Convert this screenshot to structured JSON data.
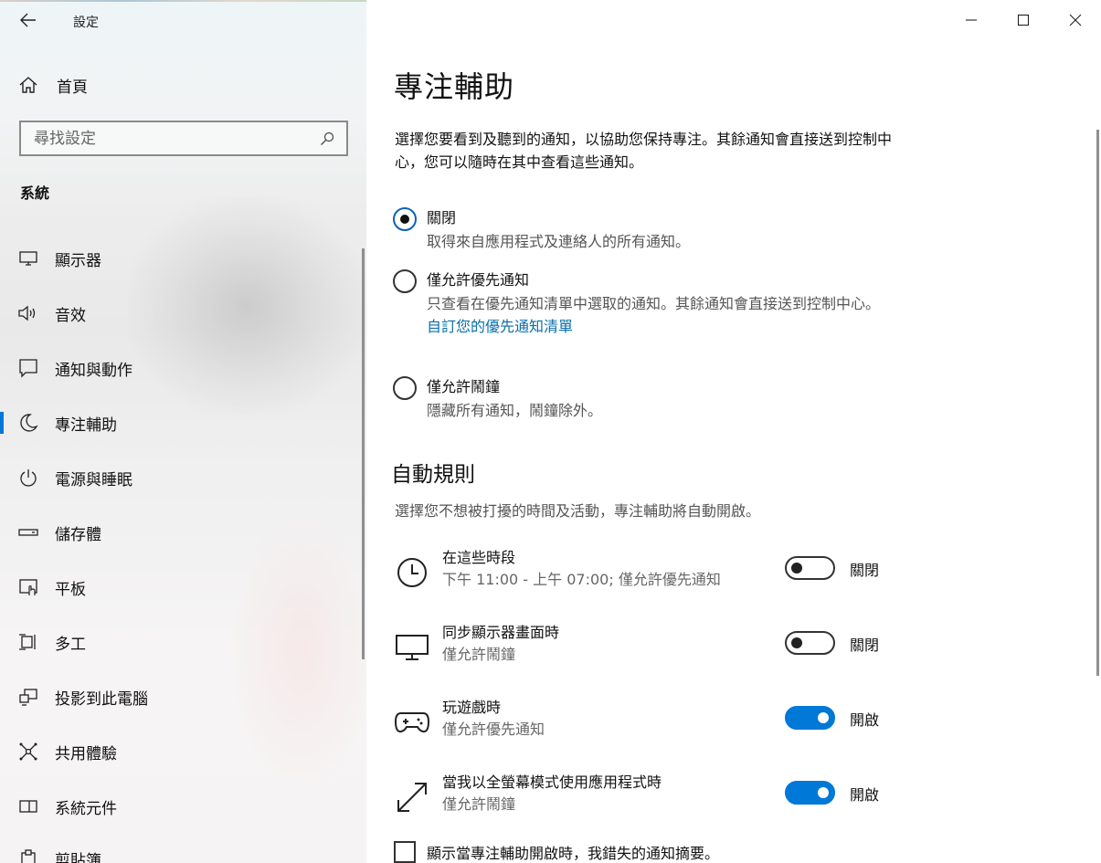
{
  "window": {
    "title": "設定",
    "controls": [
      "minimize",
      "maximize",
      "close"
    ]
  },
  "sidebar": {
    "home_label": "首頁",
    "search_placeholder": "尋找設定",
    "section_title": "系統",
    "items": [
      {
        "label": "顯示器",
        "icon": "monitor-icon"
      },
      {
        "label": "音效",
        "icon": "speaker-icon"
      },
      {
        "label": "通知與動作",
        "icon": "notification-icon"
      },
      {
        "label": "專注輔助",
        "icon": "moon-icon",
        "active": true
      },
      {
        "label": "電源與睡眠",
        "icon": "power-icon"
      },
      {
        "label": "儲存體",
        "icon": "storage-icon"
      },
      {
        "label": "平板",
        "icon": "tablet-icon"
      },
      {
        "label": "多工",
        "icon": "multitask-icon"
      },
      {
        "label": "投影到此電腦",
        "icon": "project-icon"
      },
      {
        "label": "共用體驗",
        "icon": "shared-icon"
      },
      {
        "label": "系統元件",
        "icon": "components-icon"
      },
      {
        "label": "剪貼簿",
        "icon": "clipboard-icon"
      }
    ]
  },
  "main": {
    "title": "專注輔助",
    "description": "選擇您要看到及聽到的通知，以協助您保持專注。其餘通知會直接送到控制中心，您可以隨時在其中查看這些通知。",
    "options": [
      {
        "title": "關閉",
        "desc": "取得來自應用程式及連絡人的所有通知。",
        "checked": true
      },
      {
        "title": "僅允許優先通知",
        "desc": "只查看在優先通知清單中選取的通知。其餘通知會直接送到控制中心。",
        "link": "自訂您的優先通知清單",
        "checked": false
      },
      {
        "title": "僅允許鬧鐘",
        "desc": "隱藏所有通知，鬧鐘除外。",
        "checked": false
      }
    ],
    "auto_rules": {
      "heading": "自動規則",
      "desc": "選擇您不想被打擾的時間及活動，專注輔助將自動開啟。",
      "rules": [
        {
          "title": "在這些時段",
          "sub": "下午 11:00 - 上午 07:00; 僅允許優先通知",
          "state": "關閉",
          "on": false,
          "icon": "clock-icon"
        },
        {
          "title": "同步顯示器畫面時",
          "sub": "僅允許鬧鐘",
          "state": "關閉",
          "on": false,
          "icon": "display-icon"
        },
        {
          "title": "玩遊戲時",
          "sub": "僅允許優先通知",
          "state": "開啟",
          "on": true,
          "icon": "gamepad-icon"
        },
        {
          "title": "當我以全螢幕模式使用應用程式時",
          "sub": "僅允許鬧鐘",
          "state": "開啟",
          "on": true,
          "icon": "fullscreen-icon"
        }
      ]
    },
    "summary_checkbox": "顯示當專注輔助開啟時，我錯失的通知摘要。"
  },
  "colors": {
    "accent": "#0078d7",
    "link": "#0a6ea8"
  }
}
